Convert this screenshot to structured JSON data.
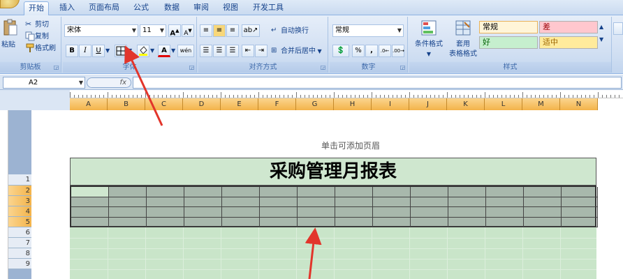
{
  "tabs": [
    "开始",
    "插入",
    "页面布局",
    "公式",
    "数据",
    "审阅",
    "视图",
    "开发工具"
  ],
  "clipboard": {
    "paste": "粘贴",
    "cut": "剪切",
    "copy": "复制",
    "format_painter": "格式刷",
    "label": "剪贴板"
  },
  "font": {
    "name": "宋体",
    "size": "11",
    "grow": "A",
    "shrink": "A",
    "bold": "B",
    "italic": "I",
    "underline": "U",
    "font_color_glyph": "A",
    "phonetic": "wén",
    "label": "字体"
  },
  "alignment": {
    "wrap_text": "自动换行",
    "merge_center": "合并后居中",
    "label": "对齐方式"
  },
  "number": {
    "format": "常规",
    "percent": "%",
    "comma": ",",
    "label": "数字"
  },
  "styles": {
    "conditional": "条件格式",
    "table_line1": "套用",
    "table_line2": "表格格式",
    "normal": "常规",
    "bad": "差",
    "good": "好",
    "neutral": "适中",
    "label": "样式"
  },
  "formula_bar": {
    "name_box": "A2",
    "fx": "fx",
    "value": ""
  },
  "columns": [
    "A",
    "B",
    "C",
    "D",
    "E",
    "F",
    "G",
    "H",
    "I",
    "J",
    "K",
    "L",
    "M",
    "N"
  ],
  "rows": [
    "1",
    "2",
    "3",
    "4",
    "5",
    "6",
    "7",
    "8",
    "9"
  ],
  "sheet": {
    "header_hint": "单击可添加页眉",
    "title": "采购管理月报表"
  },
  "colors": {
    "accent_arrow": "#e2352b",
    "selected_header": "#f3b34a",
    "title_fill": "#cfe7cf",
    "table_fill": "#a8b8ac",
    "body_fill": "#c9e5c9"
  }
}
